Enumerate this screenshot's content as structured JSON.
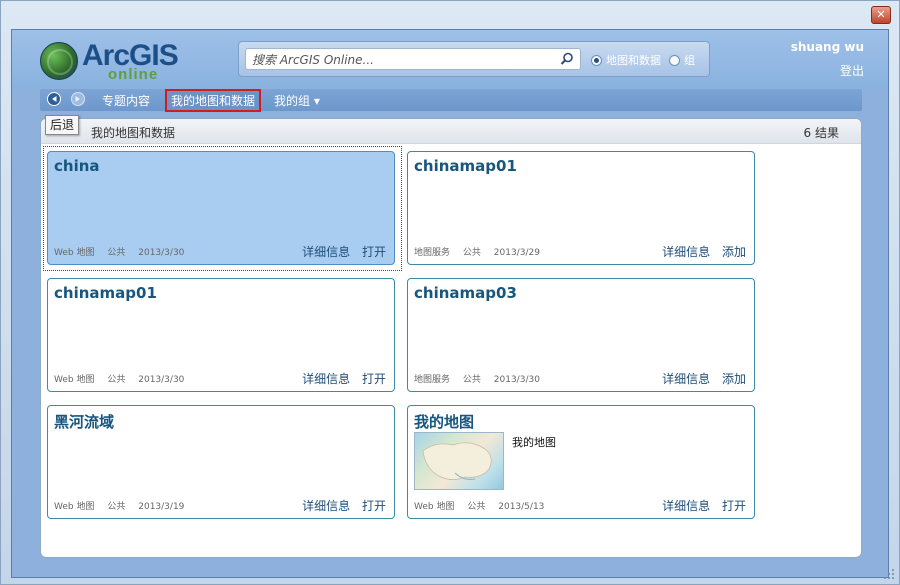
{
  "window": {
    "close_label": "✕"
  },
  "header": {
    "logo_text": "ArcGIS",
    "logo_subtext": "online",
    "search_placeholder": "搜索 ArcGIS Online...",
    "radio_maps_label": "地图和数据",
    "radio_groups_label": "组",
    "user_name": "shuang wu",
    "logout_label": "登出"
  },
  "nav": {
    "featured_label": "专题内容",
    "mymaps_label": "我的地图和数据",
    "mygroups_label": "我的组 ▾",
    "back_tooltip": "后退"
  },
  "panel": {
    "title": "我的地图和数据",
    "result_count": "6 结果"
  },
  "cards": [
    {
      "title": "china",
      "type": "Web 地图",
      "access": "公共",
      "date": "2013/3/30",
      "details_label": "详细信息",
      "action_label": "打开",
      "selected": true
    },
    {
      "title": "chinamap01",
      "type": "地图服务",
      "access": "公共",
      "date": "2013/3/29",
      "details_label": "详细信息",
      "action_label": "添加"
    },
    {
      "title": "chinamap01",
      "type": "Web 地图",
      "access": "公共",
      "date": "2013/3/30",
      "details_label": "详细信息",
      "action_label": "打开"
    },
    {
      "title": "chinamap03",
      "type": "地图服务",
      "access": "公共",
      "date": "2013/3/30",
      "details_label": "详细信息",
      "action_label": "添加"
    },
    {
      "title": "黑河流域",
      "type": "Web 地图",
      "access": "公共",
      "date": "2013/3/19",
      "details_label": "详细信息",
      "action_label": "打开"
    },
    {
      "title": "我的地图",
      "type": "Web 地图",
      "access": "公共",
      "date": "2013/5/13",
      "details_label": "详细信息",
      "action_label": "打开",
      "description": "我的地图"
    }
  ],
  "colors": {
    "accent": "#17567d",
    "selected_card": "#a9cdf1",
    "nav_highlight": "#d21b1b"
  }
}
